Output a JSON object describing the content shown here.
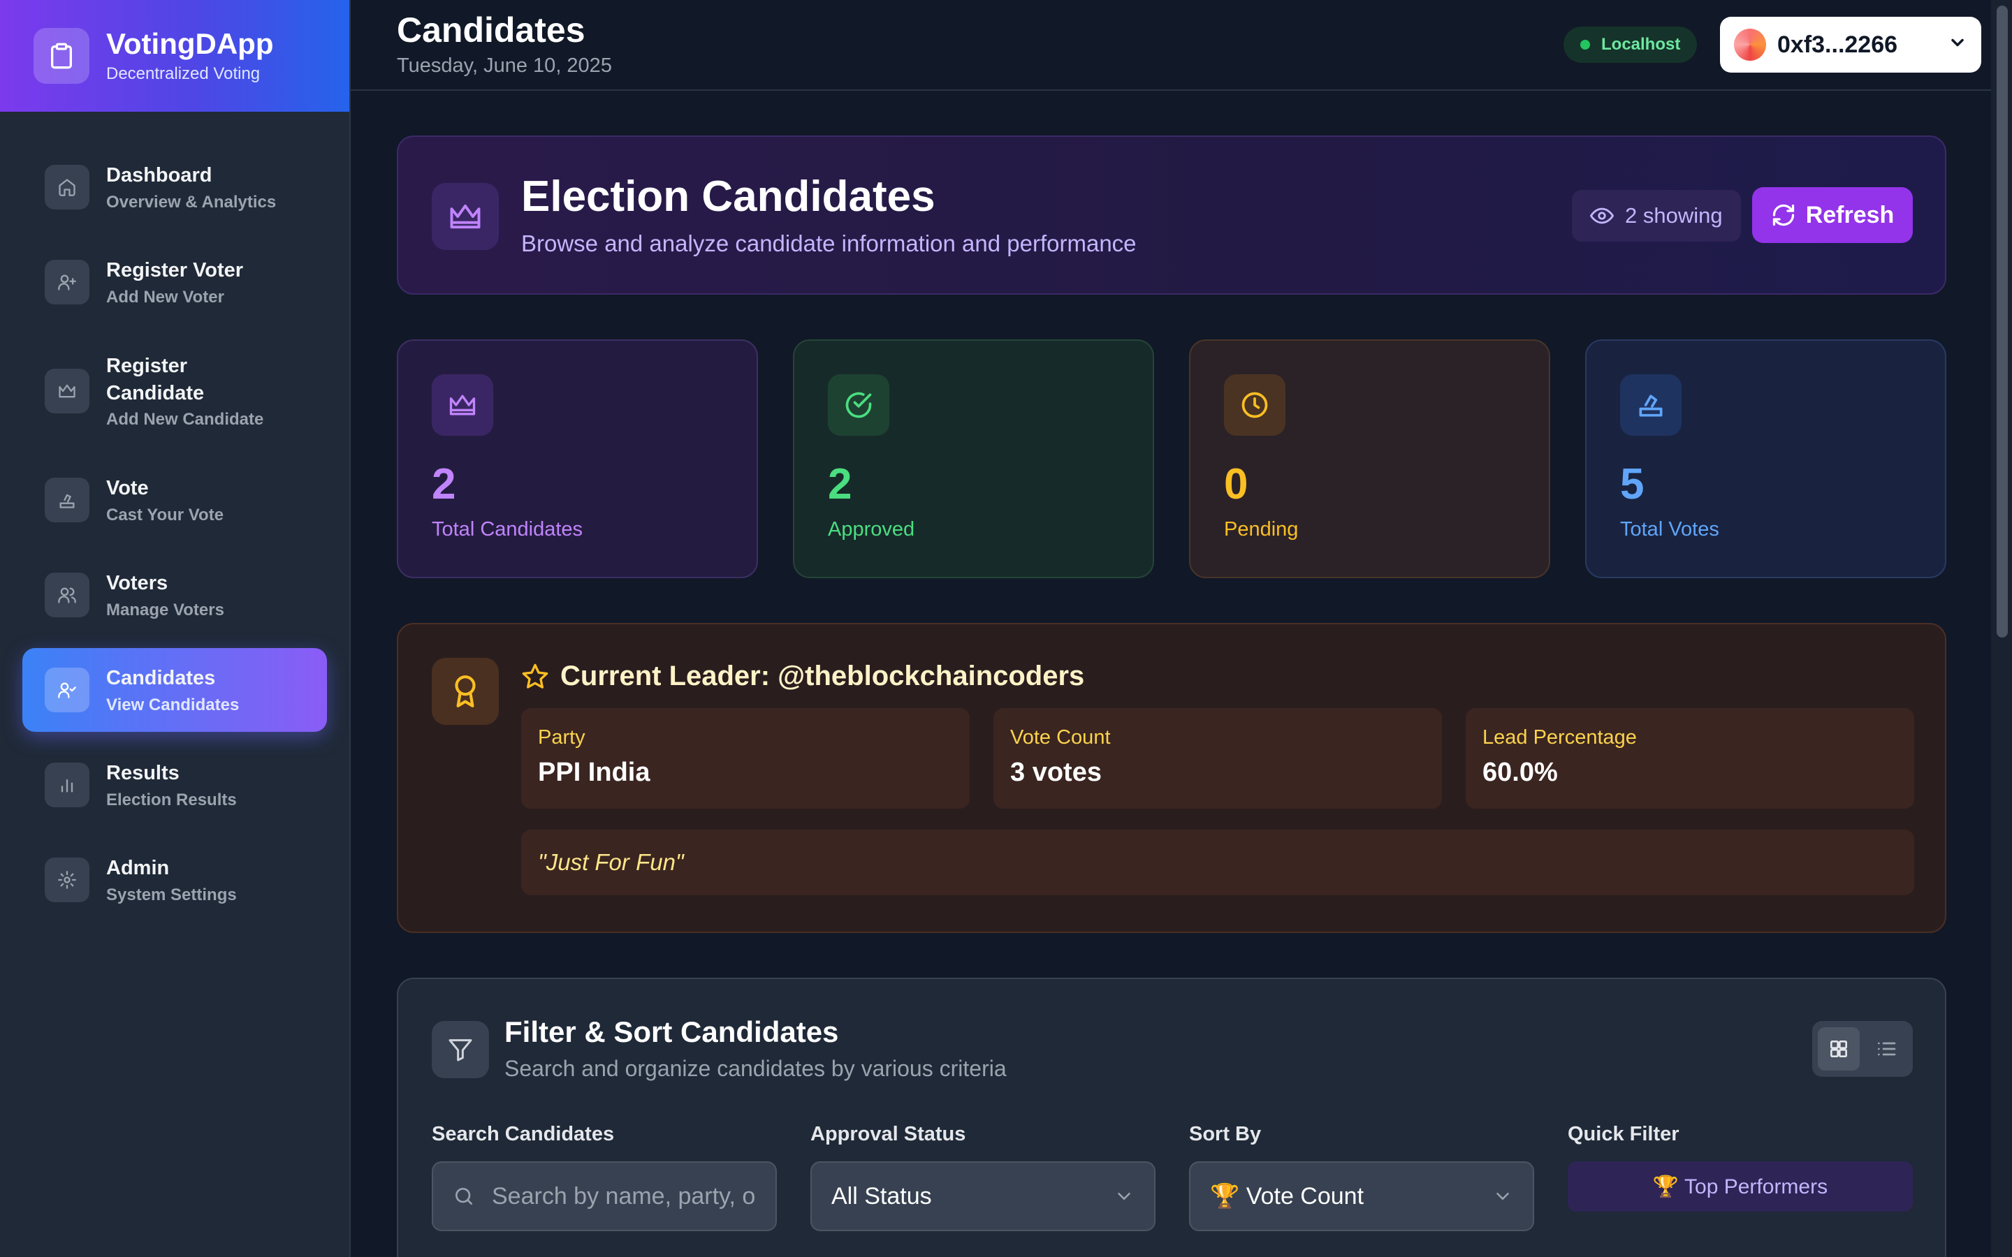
{
  "brand": {
    "title": "VotingDApp",
    "subtitle": "Decentralized Voting"
  },
  "sidebar": {
    "items": [
      {
        "label": "Dashboard",
        "sub": "Overview & Analytics",
        "icon": "home-icon"
      },
      {
        "label": "Register Voter",
        "sub": "Add New Voter",
        "icon": "user-plus-icon"
      },
      {
        "label": "Register Candidate",
        "sub": "Add New Candidate",
        "icon": "crown-icon"
      },
      {
        "label": "Vote",
        "sub": "Cast Your Vote",
        "icon": "ballot-icon"
      },
      {
        "label": "Voters",
        "sub": "Manage Voters",
        "icon": "users-icon"
      },
      {
        "label": "Candidates",
        "sub": "View Candidates",
        "icon": "user-check-icon",
        "active": true
      },
      {
        "label": "Results",
        "sub": "Election Results",
        "icon": "bar-chart-icon"
      },
      {
        "label": "Admin",
        "sub": "System Settings",
        "icon": "gear-icon"
      }
    ]
  },
  "header": {
    "title": "Candidates",
    "date": "Tuesday, June 10, 2025",
    "network": "Localhost",
    "wallet": "0xf3...2266"
  },
  "hero": {
    "title": "Election Candidates",
    "subtitle": "Browse and analyze candidate information and performance",
    "showing": "2 showing",
    "refresh": "Refresh"
  },
  "stats": [
    {
      "value": "2",
      "label": "Total Candidates",
      "color": "#c084fc"
    },
    {
      "value": "2",
      "label": "Approved",
      "color": "#4ade80"
    },
    {
      "value": "0",
      "label": "Pending",
      "color": "#fbbf24"
    },
    {
      "value": "5",
      "label": "Total Votes",
      "color": "#60a5fa"
    }
  ],
  "leader": {
    "title": "Current Leader: @theblockchaincoders",
    "party_label": "Party",
    "party_value": "PPI India",
    "votes_label": "Vote Count",
    "votes_value": "3 votes",
    "lead_label": "Lead Percentage",
    "lead_value": "60.0%",
    "quote": "\"Just For Fun\""
  },
  "filter": {
    "title": "Filter & Sort Candidates",
    "subtitle": "Search and organize candidates by various criteria",
    "search_label": "Search Candidates",
    "search_placeholder": "Search by name, party, o",
    "status_label": "Approval Status",
    "status_value": "All Status",
    "sort_label": "Sort By",
    "sort_value": "🏆 Vote Count",
    "quick_label": "Quick Filter",
    "quick_value": "🏆 Top Performers"
  },
  "colors": {
    "accent": "#9333ea",
    "brand_from": "#7c3aed",
    "brand_to": "#2563eb"
  }
}
